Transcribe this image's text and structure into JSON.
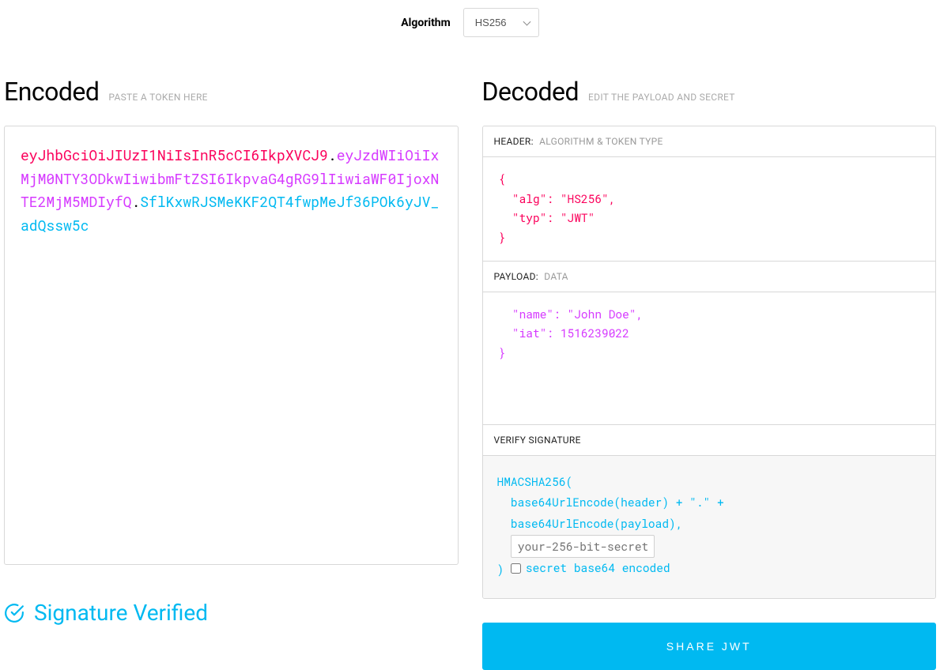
{
  "algorithm": {
    "label": "Algorithm",
    "selected": "HS256"
  },
  "encoded": {
    "title": "Encoded",
    "subtitle": "PASTE A TOKEN HERE",
    "token": {
      "header": "eyJhbGciOiJIUzI1NiIsInR5cCI6IkpXVCJ9",
      "payload": "eyJzdWIiOiIxMjM0NTY3ODkwIiwibmFtZSI6IkpvaG4gRG9lIiwiaWF0IjoxNTE2MjM5MDIyfQ",
      "signature": "SflKxwRJSMeKKF2QT4fwpMeJf36POk6yJV_adQssw5c"
    }
  },
  "decoded": {
    "title": "Decoded",
    "subtitle": "EDIT THE PAYLOAD AND SECRET",
    "header_section": {
      "label": "HEADER:",
      "sublabel": "ALGORITHM & TOKEN TYPE",
      "json": "{\n  \"alg\": \"HS256\",\n  \"typ\": \"JWT\"\n}"
    },
    "payload_section": {
      "label": "PAYLOAD:",
      "sublabel": "DATA",
      "json": "  \"name\": \"John Doe\",\n  \"iat\": 1516239022\n}"
    },
    "signature_section": {
      "label": "VERIFY SIGNATURE",
      "line1": "HMACSHA256(",
      "line2": "  base64UrlEncode(header) + \".\" +",
      "line3": "  base64UrlEncode(payload),",
      "secret_placeholder": "your-256-bit-secret",
      "close_paren": ") ",
      "checkbox_label": "secret base64 encoded"
    }
  },
  "status": {
    "text": "Signature Verified"
  },
  "share_button": {
    "label": "SHARE JWT"
  }
}
